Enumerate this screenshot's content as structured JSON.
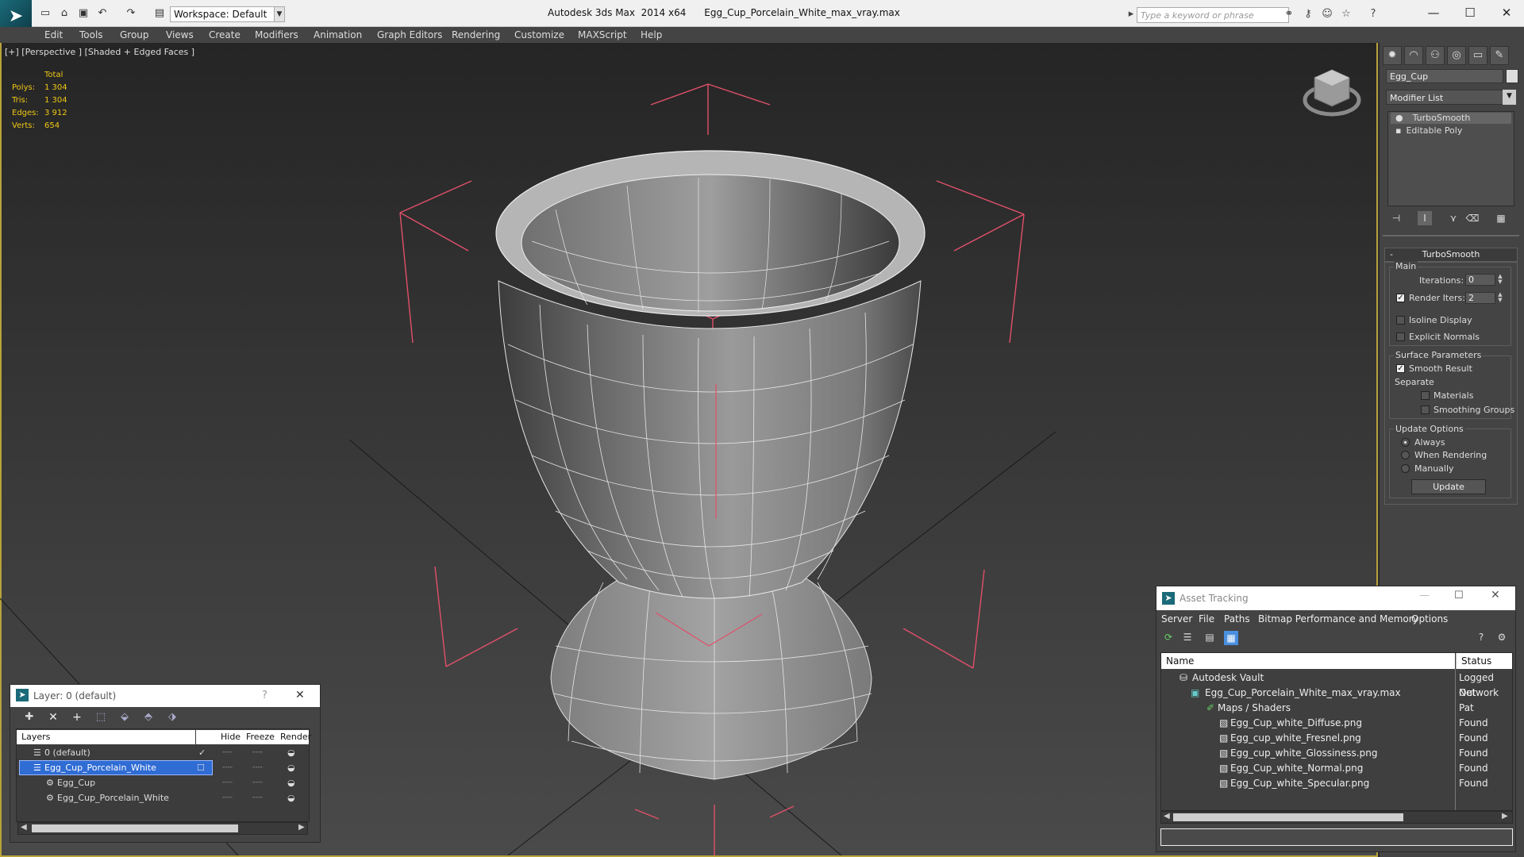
{
  "titlebar": {
    "workspace": "Workspace: Default",
    "app_title": "Autodesk 3ds Max  2014 x64",
    "file_title": "Egg_Cup_Porcelain_White_max_vray.max",
    "search_placeholder": "Type a keyword or phrase"
  },
  "menu": [
    "Edit",
    "Tools",
    "Group",
    "Views",
    "Create",
    "Modifiers",
    "Animation",
    "Graph Editors",
    "Rendering",
    "Customize",
    "MAXScript",
    "Help"
  ],
  "viewport": {
    "label": "[+] [Perspective ] [Shaded + Edged Faces ]",
    "stats": {
      "header": "Total",
      "rows": [
        {
          "label": "Polys:",
          "value": "1 304"
        },
        {
          "label": "Tris:",
          "value": "1 304"
        },
        {
          "label": "Edges:",
          "value": "3 912"
        },
        {
          "label": "Verts:",
          "value": "654"
        }
      ]
    }
  },
  "command_panel": {
    "object_name": "Egg_Cup",
    "modifier_list": "Modifier List",
    "stack": [
      "TurboSmooth",
      "Editable Poly"
    ],
    "rollout_title": "TurboSmooth",
    "main": {
      "group": "Main",
      "iterations_label": "Iterations:",
      "iterations_value": "0",
      "render_iters_label": "Render Iters:",
      "render_iters_value": "2",
      "isoline_label": "Isoline Display",
      "explicit_label": "Explicit Normals"
    },
    "surface": {
      "group": "Surface Parameters",
      "smooth_result": "Smooth Result",
      "separate": "Separate",
      "materials": "Materials",
      "smoothing_groups": "Smoothing Groups"
    },
    "update": {
      "group": "Update Options",
      "always": "Always",
      "when_rendering": "When Rendering",
      "manually": "Manually",
      "button": "Update"
    }
  },
  "layer_dialog": {
    "title": "Layer: 0 (default)",
    "help": "?",
    "close": "✕",
    "headers": {
      "layers": "Layers",
      "hide": "Hide",
      "freeze": "Freeze",
      "render": "Render"
    },
    "rows": [
      {
        "name": "0 (default)",
        "selected": false
      },
      {
        "name": "Egg_Cup_Porcelain_White",
        "selected": true
      },
      {
        "name": "Egg_Cup",
        "selected": false
      },
      {
        "name": "Egg_Cup_Porcelain_White",
        "selected": false
      }
    ]
  },
  "asset_tracking": {
    "title": "Asset Tracking",
    "menu": [
      "Server",
      "File",
      "Paths",
      "Bitmap Performance and Memory",
      "Options"
    ],
    "headers": {
      "name": "Name",
      "status": "Status"
    },
    "rows": [
      {
        "name": "Autodesk Vault",
        "status": "Logged Out"
      },
      {
        "name": "Egg_Cup_Porcelain_White_max_vray.max",
        "status": "Network Pat"
      },
      {
        "name": "Maps / Shaders",
        "status": ""
      },
      {
        "name": "Egg_Cup_white_Diffuse.png",
        "status": "Found"
      },
      {
        "name": "Egg_cup_white_Fresnel.png",
        "status": "Found"
      },
      {
        "name": "Egg_cup_white_Glossiness.png",
        "status": "Found"
      },
      {
        "name": "Egg_Cup_white_Normal.png",
        "status": "Found"
      },
      {
        "name": "Egg_Cup_white_Specular.png",
        "status": "Found"
      }
    ]
  }
}
